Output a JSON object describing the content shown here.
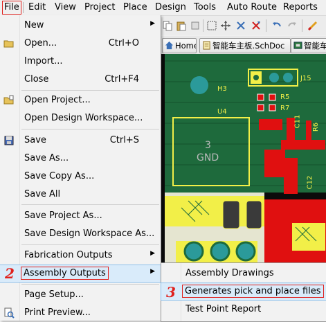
{
  "menubar": {
    "items": [
      "File",
      "Edit",
      "View",
      "Project",
      "Place",
      "Design",
      "Tools",
      "Auto Route",
      "Reports"
    ]
  },
  "tabs": [
    {
      "label": "Home",
      "icon": "home-icon"
    },
    {
      "label": "智能车主板.SchDoc",
      "icon": "schematic-doc-icon"
    },
    {
      "label": "智能车",
      "icon": "pcb-doc-icon"
    }
  ],
  "pcb": {
    "labels": {
      "h3": "H3",
      "u4": "U4",
      "j15": "J15",
      "r5": "R5",
      "r7": "R7",
      "c11": "C11",
      "r6": "R6",
      "c12": "C12",
      "pad_num": "3",
      "pad_net": "GND"
    },
    "colors": {
      "board": "#0b0b0b",
      "copper_top": "#e01010",
      "copper_bottom": "#1e6a3c",
      "overlay": "#f2ef48",
      "pad": "#c9c9c9",
      "via": "#2b9a9a"
    }
  },
  "file_menu": {
    "items": [
      {
        "label": "New",
        "shortcut": "",
        "submenu": true
      },
      {
        "label": "Open...",
        "shortcut": "Ctrl+O"
      },
      {
        "label": "Import...",
        "shortcut": ""
      },
      {
        "label": "Close",
        "shortcut": "Ctrl+F4"
      },
      {
        "label": "Open Project...",
        "shortcut": ""
      },
      {
        "label": "Open Design Workspace...",
        "shortcut": ""
      },
      {
        "label": "Save",
        "shortcut": "Ctrl+S"
      },
      {
        "label": "Save As...",
        "shortcut": ""
      },
      {
        "label": "Save Copy As...",
        "shortcut": ""
      },
      {
        "label": "Save All",
        "shortcut": ""
      },
      {
        "label": "Save Project As...",
        "shortcut": ""
      },
      {
        "label": "Save Design Workspace As...",
        "shortcut": ""
      },
      {
        "label": "Fabrication Outputs",
        "shortcut": "",
        "submenu": true
      },
      {
        "label": "Assembly Outputs",
        "shortcut": "",
        "submenu": true,
        "highlighted": true
      },
      {
        "label": "Page Setup...",
        "shortcut": ""
      },
      {
        "label": "Print Preview...",
        "shortcut": ""
      }
    ]
  },
  "assembly_submenu": {
    "items": [
      {
        "label": "Assembly Drawings"
      },
      {
        "label": "Generates pick and place files",
        "highlighted": true
      },
      {
        "label": "Test Point Report"
      }
    ]
  },
  "annotations": {
    "step2": "2",
    "step3": "3",
    "color": "#e0201c"
  }
}
